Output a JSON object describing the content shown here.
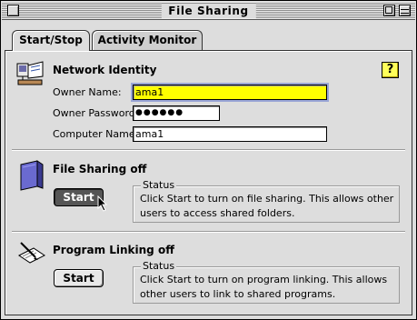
{
  "window": {
    "title": "File Sharing"
  },
  "tabs": [
    {
      "label": "Start/Stop",
      "active": true
    },
    {
      "label": "Activity Monitor",
      "active": false
    }
  ],
  "network_identity": {
    "heading": "Network Identity",
    "owner_name_label": "Owner Name:",
    "owner_name_value": "ama1",
    "owner_password_label": "Owner Password:",
    "owner_password_value": "●●●●●●",
    "computer_name_label": "Computer Name:",
    "computer_name_value": "ama1",
    "help_label": "?"
  },
  "file_sharing": {
    "heading": "File Sharing off",
    "button_label": "Start",
    "status_legend": "Status",
    "status_text": "Click Start to turn on file sharing. This allows other users to access shared folders."
  },
  "program_linking": {
    "heading": "Program Linking off",
    "button_label": "Start",
    "status_legend": "Status",
    "status_text": "Click Start to turn on program linking. This allows other users to link to shared programs."
  },
  "icons": {
    "close": "close-box-icon",
    "zoom": "zoom-box-icon",
    "collapse": "collapse-box-icon",
    "network": "network-identity-icon",
    "folder": "shared-folder-icon",
    "linking": "program-linking-icon",
    "cursor": "mouse-pointer-icon"
  },
  "colors": {
    "focus_field": "#ffff00",
    "help_badge": "#ffff5a",
    "window_bg": "#dddddd"
  }
}
